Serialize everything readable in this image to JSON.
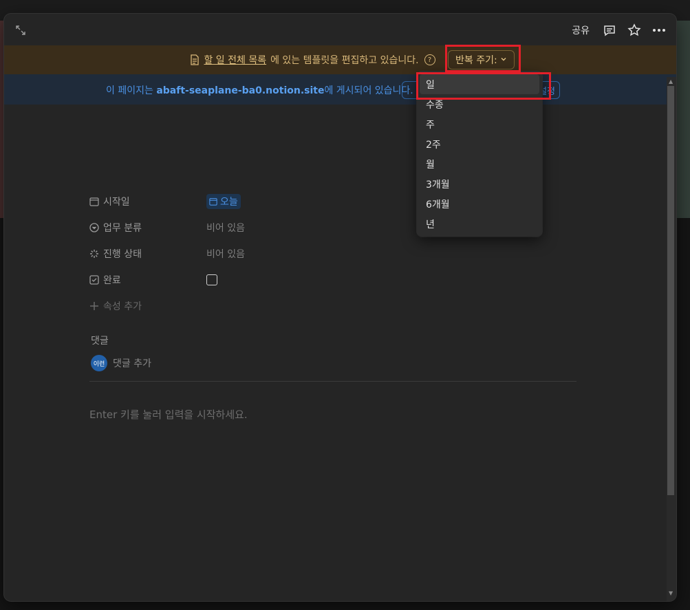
{
  "background": {
    "banner_text": "이 페이지는 abaft-seaplane-ba0.notion.site에 게시되어 있습니다."
  },
  "topbar": {
    "share_label": "공유",
    "icons": [
      "expand-icon",
      "comment-icon",
      "star-icon",
      "more-icon"
    ]
  },
  "template_bar": {
    "prefix": "할 일 전체 목록",
    "suffix": "에 있는 템플릿을 편집하고 있습니다.",
    "repeat_label": "반복 주기:"
  },
  "publish_bar": {
    "prefix": "이 페이지는 ",
    "site": "abaft-seaplane-ba0.notion.site",
    "suffix": "에 게시되어 있습니다.",
    "settings_tail": "설정"
  },
  "properties": [
    {
      "label": "시작일",
      "value": "오늘",
      "icon": "calendar-icon"
    },
    {
      "label": "업무 분류",
      "value": "비어 있음",
      "icon": "select-icon"
    },
    {
      "label": "진행 상태",
      "value": "비어 있음",
      "icon": "status-icon"
    },
    {
      "label": "완료",
      "value": "",
      "icon": "checkbox-icon"
    }
  ],
  "add_property_label": "속성 추가",
  "comments": {
    "title": "댓글",
    "avatar_text": "이런",
    "add_label": "댓글 추가"
  },
  "editor_placeholder": "Enter 키를 눌러 입력을 시작하세요.",
  "dropdown": {
    "items": [
      "일",
      "수종",
      "주",
      "2주",
      "월",
      "3개월",
      "6개월",
      "년"
    ],
    "selected_index": 0
  },
  "colors": {
    "highlight": "#e3202a",
    "template_bar_bg": "#3a2d1a",
    "publish_bar_bg": "#1f2b3a",
    "modal_bg": "#252525"
  }
}
